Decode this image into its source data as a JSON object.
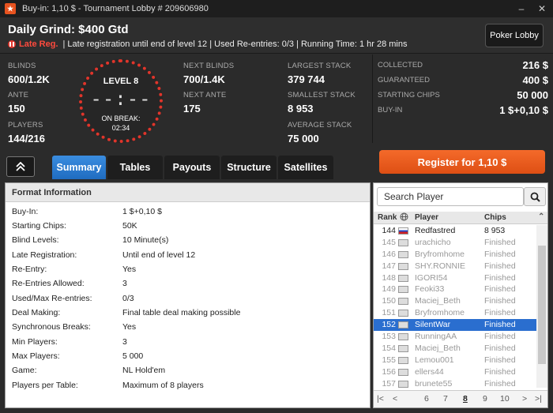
{
  "window": {
    "title": "Buy-in: 1,10 $ - Tournament Lobby # 209606980",
    "logo_icon": "pokerstars-logo-icon",
    "min_icon": "minimize-icon",
    "close_icon": "close-icon"
  },
  "header": {
    "tournament_name": "Daily Grind: $400 Gtd",
    "late_reg_label": "Late Reg.",
    "info_line": "| Late registration until end of level 12 | Used Re-entries: 0/3 | Running Time: 1 hr  28 mins",
    "lobby_button": "Poker Lobby"
  },
  "stats": {
    "blinds_label": "BLINDS",
    "blinds_value": "600/1.2K",
    "ante_label": "ANTE",
    "ante_value": "150",
    "players_label": "PLAYERS",
    "players_value": "144/216",
    "level_label": "LEVEL 8",
    "clock": "--:--",
    "break_label": "ON BREAK:",
    "break_time": "02:34",
    "next_blinds_label": "NEXT BLINDS",
    "next_blinds_value": "700/1.4K",
    "next_ante_label": "NEXT ANTE",
    "next_ante_value": "175",
    "largest_label": "LARGEST STACK",
    "largest_value": "379 744",
    "smallest_label": "SMALLEST STACK",
    "smallest_value": "8 953",
    "average_label": "AVERAGE STACK",
    "average_value": "75 000"
  },
  "prize": {
    "collected_label": "COLLECTED",
    "collected_value": "216 $",
    "guaranteed_label": "GUARANTEED",
    "guaranteed_value": "400 $",
    "starting_label": "STARTING CHIPS",
    "starting_value": "50 000",
    "buyin_label": "BUY-IN",
    "buyin_value": "1 $+0,10 $"
  },
  "register_button": "Register for  1,10 $",
  "tabs": [
    {
      "label": "Summary",
      "active": true
    },
    {
      "label": "Tables"
    },
    {
      "label": "Payouts"
    },
    {
      "label": "Structure"
    },
    {
      "label": "Satellites"
    }
  ],
  "format": {
    "heading": "Format Information",
    "rows": [
      {
        "k": "Buy-In:",
        "v": "1 $+0,10 $"
      },
      {
        "k": "Starting Chips:",
        "v": "50K"
      },
      {
        "k": "Blind Levels:",
        "v": "10 Minute(s)"
      },
      {
        "k": "Late Registration:",
        "v": "Until end of level 12"
      },
      {
        "k": "Re-Entry:",
        "v": "Yes"
      },
      {
        "k": "Re-Entries Allowed:",
        "v": "3"
      },
      {
        "k": "Used/Max Re-entries:",
        "v": "0/3"
      },
      {
        "k": "Deal Making:",
        "v": "Final table deal making possible"
      },
      {
        "k": "Synchronous Breaks:",
        "v": "Yes"
      },
      {
        "k": "Min Players:",
        "v": "3"
      },
      {
        "k": "Max Players:",
        "v": "5 000"
      },
      {
        "k": "Game:",
        "v": "NL Hold'em"
      },
      {
        "k": "Players per Table:",
        "v": "Maximum of 8 players"
      }
    ]
  },
  "players": {
    "search_placeholder": "Search Player",
    "col_rank": "Rank",
    "col_player": "Player",
    "col_chips": "Chips",
    "rows": [
      {
        "rank": "144",
        "name": "Redfastred",
        "chips": "8 953"
      },
      {
        "rank": "145",
        "name": "urachicho",
        "chips": "Finished"
      },
      {
        "rank": "146",
        "name": "Bryfromhome",
        "chips": "Finished"
      },
      {
        "rank": "147",
        "name": "SHY.RONNIE",
        "chips": "Finished"
      },
      {
        "rank": "148",
        "name": "IGORI54",
        "chips": "Finished"
      },
      {
        "rank": "149",
        "name": "Feoki33",
        "chips": "Finished"
      },
      {
        "rank": "150",
        "name": "Maciej_Beth",
        "chips": "Finished"
      },
      {
        "rank": "151",
        "name": "Bryfromhome",
        "chips": "Finished"
      },
      {
        "rank": "152",
        "name": "SilentWar",
        "chips": "Finished"
      },
      {
        "rank": "153",
        "name": "RunningAA",
        "chips": "Finished"
      },
      {
        "rank": "154",
        "name": "Maciej_Beth",
        "chips": "Finished"
      },
      {
        "rank": "155",
        "name": "Lemou001",
        "chips": "Finished"
      },
      {
        "rank": "156",
        "name": "ellers44",
        "chips": "Finished"
      },
      {
        "rank": "157",
        "name": "brunete55",
        "chips": "Finished"
      }
    ],
    "pages": [
      "6",
      "7",
      "8",
      "9",
      "10"
    ],
    "current_page": "8"
  }
}
